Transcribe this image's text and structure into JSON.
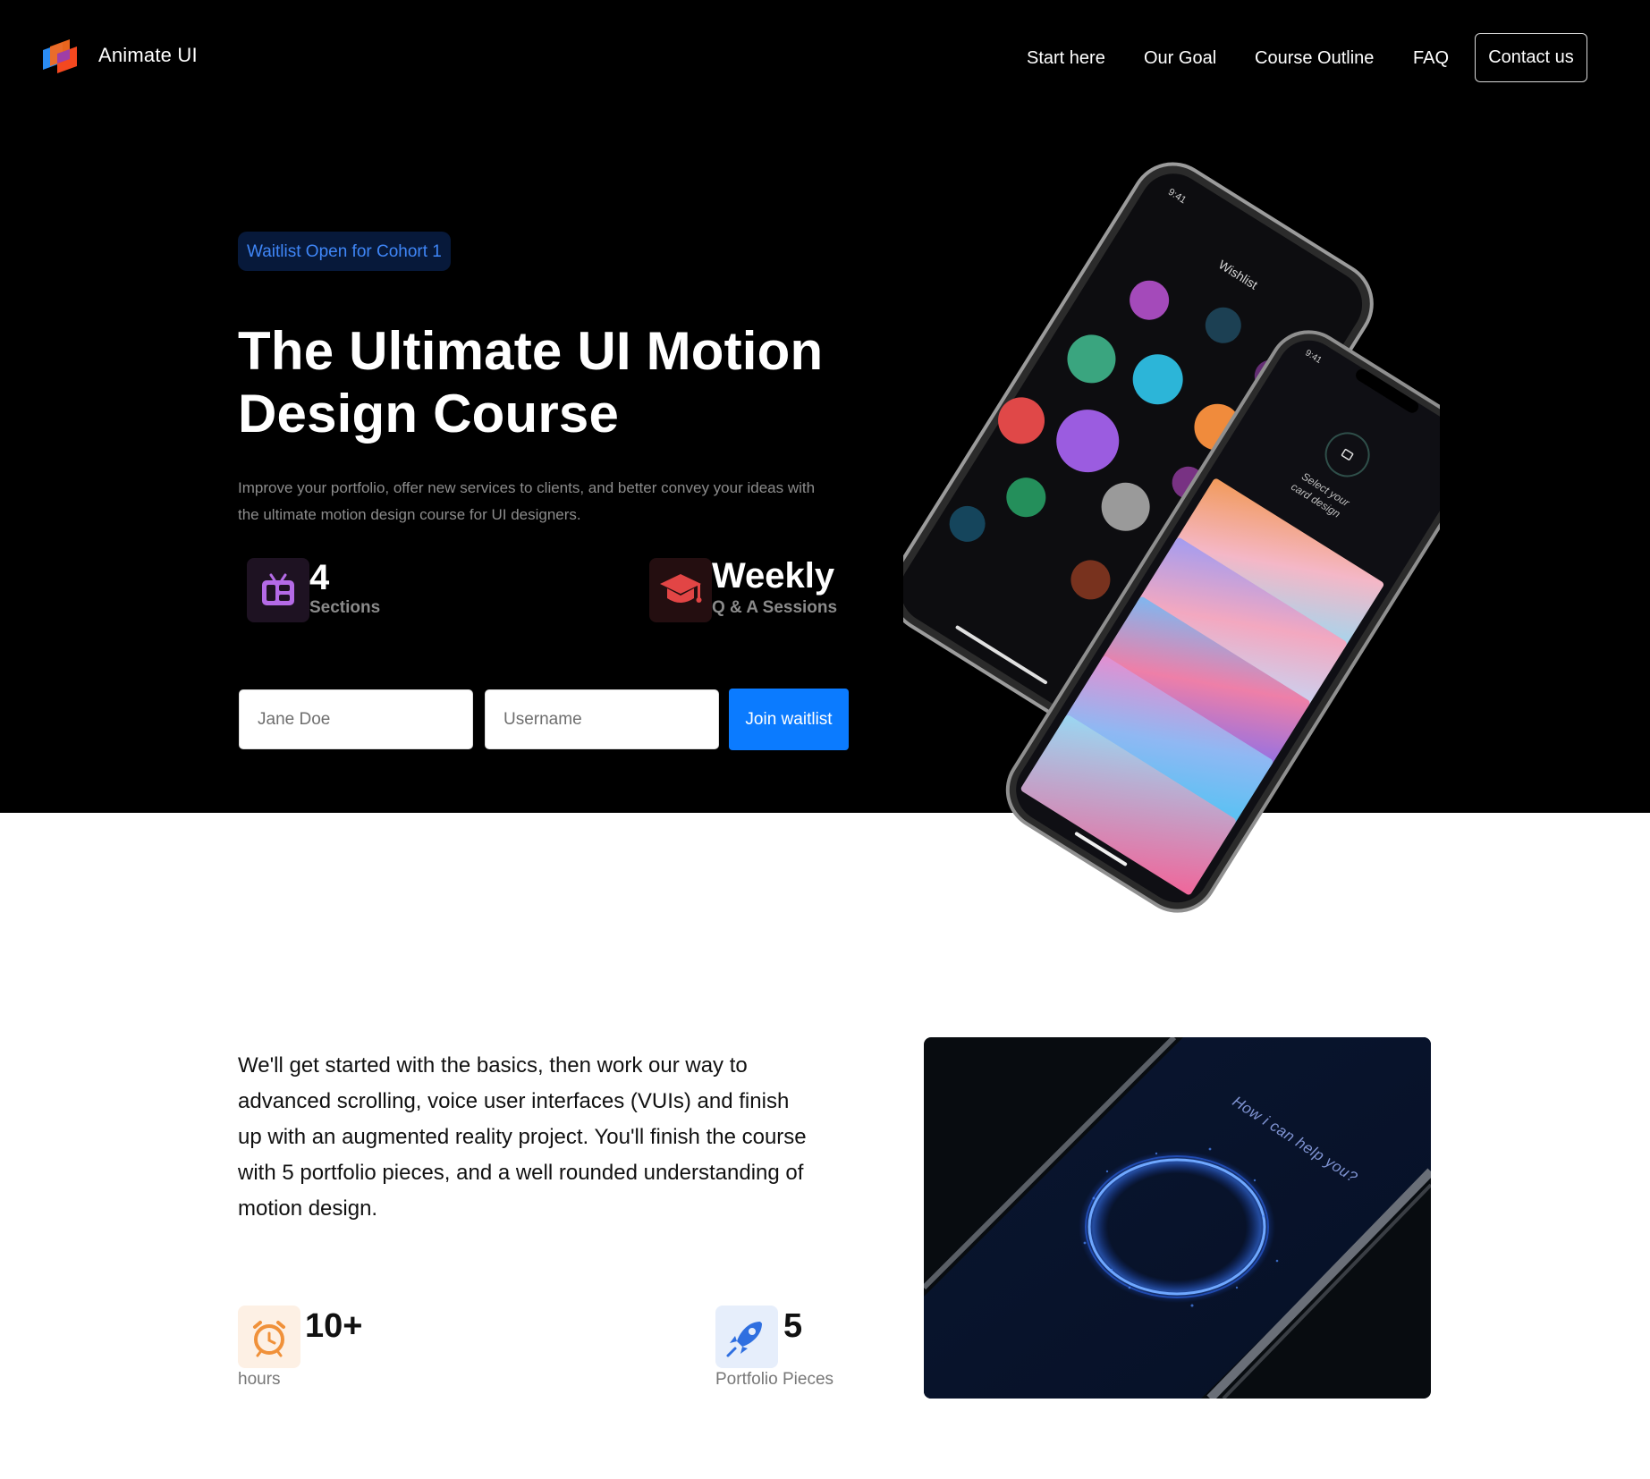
{
  "brand": {
    "name": "Animate UI",
    "logo_icon": "layers-logo-icon"
  },
  "nav": {
    "links": [
      "Start here",
      "Our Goal",
      "Course Outline",
      "FAQ"
    ],
    "contact_label": "Contact us"
  },
  "hero": {
    "badge": "Waitlist Open for Cohort 1",
    "title_line1": "The Ultimate UI Motion",
    "title_line2": "Design Course",
    "subtitle_line1": "Improve your portfolio, offer new services to clients, and better convey your ideas with",
    "subtitle_line2": "the ultimate motion design course for UI designers.",
    "stats": [
      {
        "icon": "tv-icon",
        "value": "4",
        "label": "Sections",
        "color": "#b46ae6"
      },
      {
        "icon": "graduation-cap-icon",
        "value": "Weekly",
        "label": "Q & A Sessions",
        "color": "#e24545"
      }
    ]
  },
  "waitlist_form": {
    "name_placeholder": "Jane Doe",
    "username_placeholder": "Username",
    "submit_label": "Join waitlist"
  },
  "phone_mockup": {
    "back_screen_title": "Wishlist",
    "back_time": "9:41",
    "front_time": "9:41",
    "front_prompt_line1": "Select your",
    "front_prompt_line2": "card design"
  },
  "details": {
    "line1": "We'll get started with the basics, then work our way to",
    "line2": "advanced scrolling, voice user interfaces (VUIs) and finish",
    "line3": "up with an augmented reality project. You'll finish the course",
    "line4": "with 5 portfolio pieces, and a well rounded understanding of",
    "line5": "motion design.",
    "stats": [
      {
        "icon": "alarm-clock-icon",
        "value": "10+",
        "label": "hours",
        "color": "#f0913a"
      },
      {
        "icon": "rocket-icon",
        "value": "5",
        "label": "Portfolio Pieces",
        "color": "#2f6fe0"
      }
    ],
    "voice_prompt": "How i can help you?"
  },
  "colors": {
    "accent": "#0b7bff",
    "badge_bg": "#07193a",
    "badge_text": "#3f86f7",
    "hero_bg": "#000000"
  }
}
